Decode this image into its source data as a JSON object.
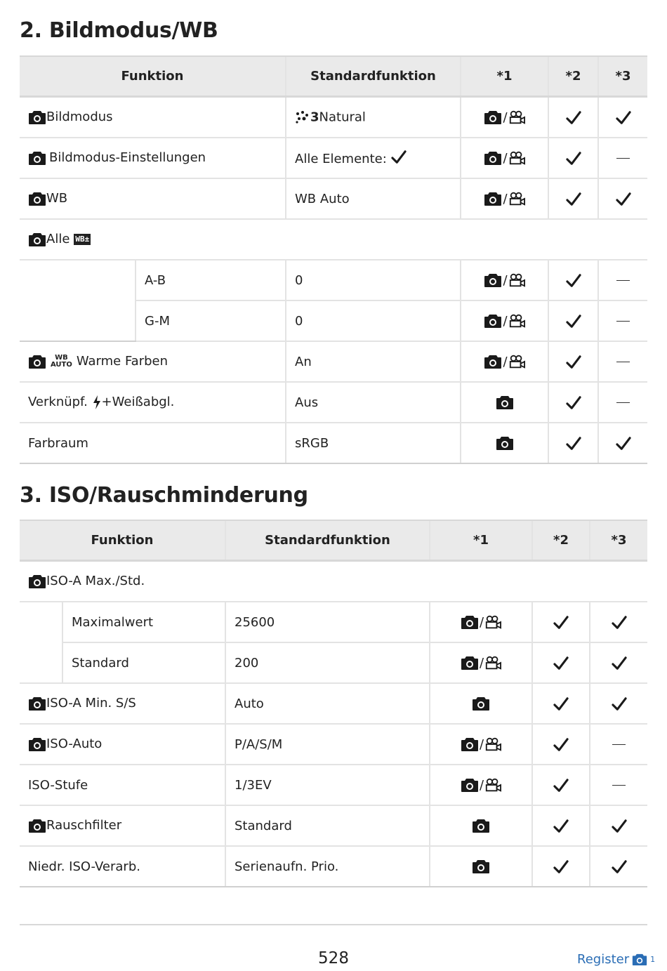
{
  "section2": {
    "title": "2. Bildmodus/WB",
    "headers": [
      "Funktion",
      "Standardfunktion",
      "*1",
      "*2",
      "*3"
    ],
    "rows": {
      "bildmodus": {
        "label": "Bildmodus",
        "default_suffix": "Natural",
        "default_prefix": "3",
        "c1": "photo-video",
        "c2": "check",
        "c3": "check"
      },
      "bildmodus_einst": {
        "label": "Bildmodus-Einstellungen",
        "default": "Alle Elemente:",
        "c1": "photo-video",
        "c2": "check",
        "c3": "dash"
      },
      "wb": {
        "label": "WB",
        "default": "WB Auto",
        "c1": "photo-video",
        "c2": "check",
        "c3": "check"
      },
      "alle": {
        "label": "Alle",
        "badge": "WB±"
      },
      "ab": {
        "label": "A-B",
        "default": "0",
        "c1": "photo-video",
        "c2": "check",
        "c3": "dash"
      },
      "gm": {
        "label": "G-M",
        "default": "0",
        "c1": "photo-video",
        "c2": "check",
        "c3": "dash"
      },
      "warm": {
        "label": "Warme Farben",
        "badge_top": "WB",
        "badge_bottom": "AUTO",
        "default": "An",
        "c1": "photo-video",
        "c2": "check",
        "c3": "dash"
      },
      "verknuepf": {
        "label_a": "Verknüpf.",
        "label_b": "+Weißabgl.",
        "default": "Aus",
        "c1": "photo",
        "c2": "check",
        "c3": "dash"
      },
      "farbraum": {
        "label": "Farbraum",
        "default": "sRGB",
        "c1": "photo",
        "c2": "check",
        "c3": "check"
      }
    }
  },
  "section3": {
    "title": "3. ISO/Rauschminderung",
    "headers": [
      "Funktion",
      "Standardfunktion",
      "*1",
      "*2",
      "*3"
    ],
    "rows": {
      "isoa": {
        "label": "ISO-A Max./Std."
      },
      "maximalwert": {
        "label": "Maximalwert",
        "default": "25600",
        "c1": "photo-video",
        "c2": "check",
        "c3": "check"
      },
      "standard": {
        "label": "Standard",
        "default": "200",
        "c1": "photo-video",
        "c2": "check",
        "c3": "check"
      },
      "isoamin": {
        "label": "ISO-A Min. S/S",
        "default": "Auto",
        "c1": "photo",
        "c2": "check",
        "c3": "check"
      },
      "isoauto": {
        "label": "ISO-Auto",
        "default": "P/A/S/M",
        "c1": "photo-video",
        "c2": "check",
        "c3": "dash"
      },
      "isostufe": {
        "label": "ISO-Stufe",
        "default": "1/3EV",
        "c1": "photo-video",
        "c2": "check",
        "c3": "dash"
      },
      "rauschfilter": {
        "label": "Rauschfilter",
        "default": "Standard",
        "c1": "photo",
        "c2": "check",
        "c3": "check"
      },
      "niedr": {
        "label": "Niedr. ISO-Verarb.",
        "default": "Serienaufn. Prio.",
        "c1": "photo",
        "c2": "check",
        "c3": "check"
      }
    }
  },
  "footer": {
    "page": "528",
    "register": "Register",
    "register_sub": "1"
  }
}
